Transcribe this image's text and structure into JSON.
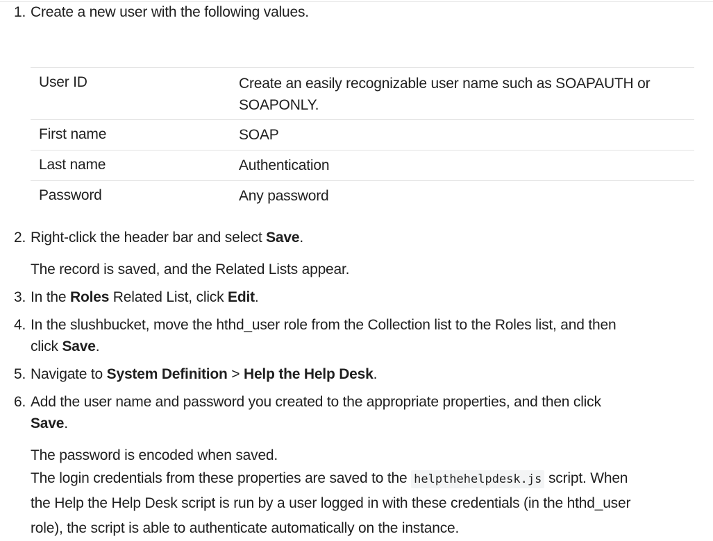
{
  "steps": {
    "s1": {
      "num": "1.",
      "text": "Create a new user with the following values."
    },
    "s2": {
      "num": "2.",
      "pre": "Right-click the header bar and select ",
      "bold": "Save",
      "post": "."
    },
    "s2_note": "The record is saved, and the Related Lists appear.",
    "s3": {
      "num": "3.",
      "pre": "In the ",
      "bold1": "Roles",
      "mid": " Related List, click ",
      "bold2": "Edit",
      "post": "."
    },
    "s4": {
      "num": "4.",
      "line1": "In the slushbucket, move the hthd_user role from the Collection list to the Roles list, and then",
      "pre2": "click ",
      "bold": "Save",
      "post": "."
    },
    "s5": {
      "num": "5.",
      "pre": "Navigate to ",
      "bold1": "System Definition",
      "mid": " > ",
      "bold2": "Help the Help Desk",
      "post": "."
    },
    "s6": {
      "num": "6.",
      "line1": "Add the user name and password you created to the appropriate properties, and then click",
      "bold": "Save",
      "post": "."
    },
    "s6_note1": "The password is encoded when saved.",
    "s6_note2_pre": "The login credentials from these properties are saved to the ",
    "s6_note2_code": "helpthehelpdesk.js",
    "s6_note2_post": " script. When",
    "s6_note3": "the Help the Help Desk script is run by a user logged in with these credentials (in the hthd_user",
    "s6_note4": "role), the script is able to authenticate automatically on the instance."
  },
  "table": {
    "rows": [
      {
        "field": "User ID",
        "value_line1": "Create an easily recognizable user name such as SOAPAUTH or",
        "value_line2": "SOAPONLY."
      },
      {
        "field": "First name",
        "value_line1": "SOAP"
      },
      {
        "field": "Last name",
        "value_line1": "Authentication"
      },
      {
        "field": "Password",
        "value_line1": "Any password"
      }
    ]
  }
}
